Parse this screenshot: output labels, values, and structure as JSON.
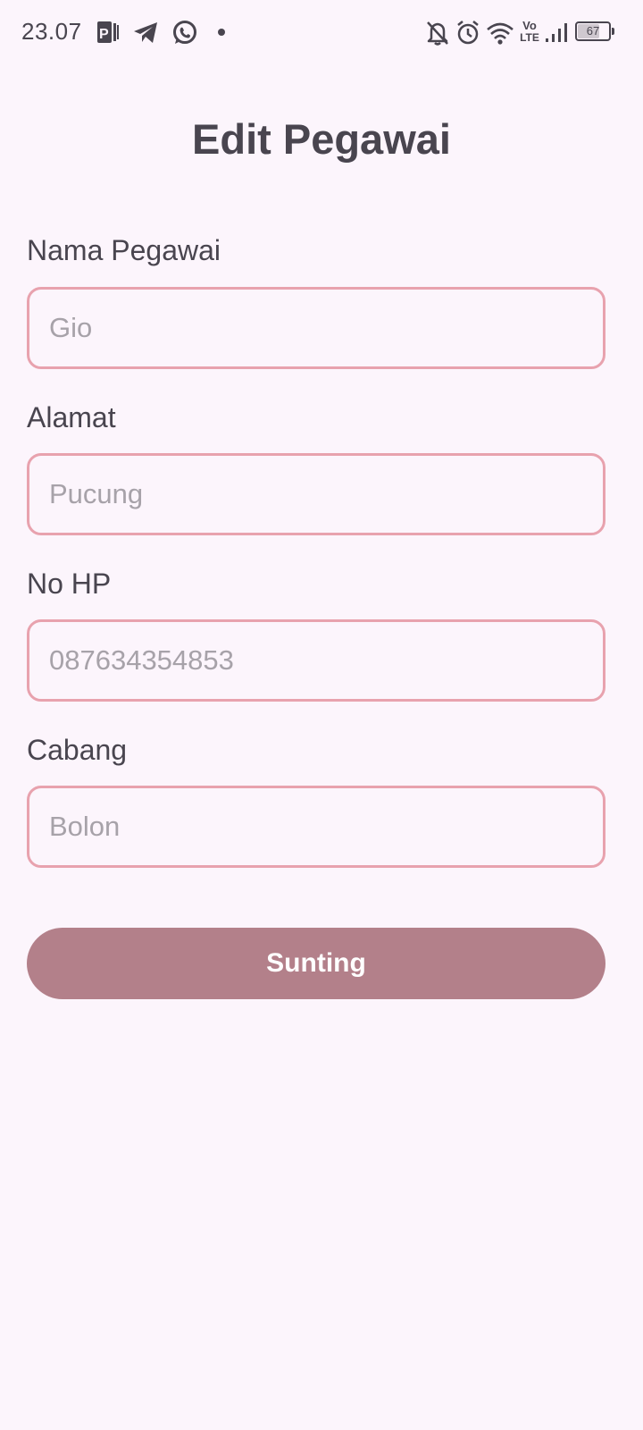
{
  "status_bar": {
    "time": "23.07",
    "battery_level": "67",
    "network_label_top": "Vo",
    "network_label_bottom": "LTE",
    "left_icons": [
      "parking-app-icon",
      "telegram-icon",
      "whatsapp-icon",
      "notification-dot-icon"
    ],
    "right_icons": [
      "notifications-off-icon",
      "alarm-icon",
      "wifi-icon",
      "volte-icon",
      "signal-icon",
      "battery-icon"
    ]
  },
  "page": {
    "title": "Edit Pegawai"
  },
  "form": {
    "fields": [
      {
        "label": "Nama Pegawai",
        "placeholder": "Gio"
      },
      {
        "label": "Alamat",
        "placeholder": "Pucung"
      },
      {
        "label": "No HP",
        "placeholder": "087634354853"
      },
      {
        "label": "Cabang",
        "placeholder": "Bolon"
      }
    ],
    "submit_label": "Sunting"
  },
  "colors": {
    "background": "#fcf5fc",
    "text": "#49454f",
    "input_border": "#e8a2ae",
    "placeholder": "#a7a2a9",
    "button": "#b3808a",
    "button_text": "#ffffff"
  }
}
